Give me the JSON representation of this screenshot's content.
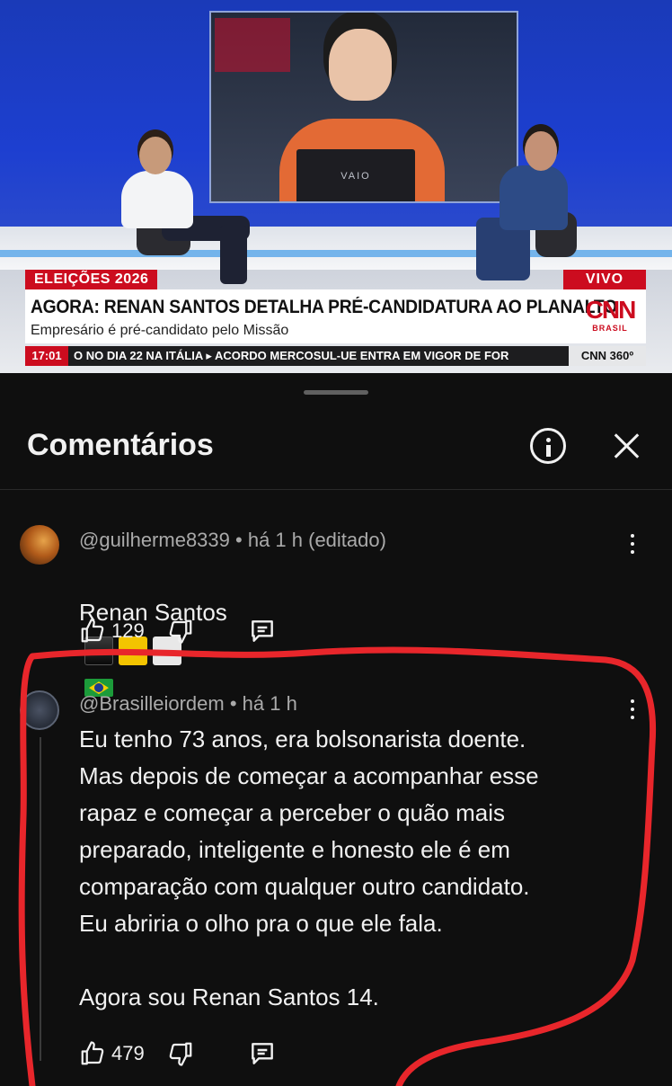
{
  "video": {
    "laptop_brand": "VAIO",
    "lower_third": {
      "tag": "ELEIÇÕES 2026",
      "live": "VIVO",
      "headline": "AGORA: RENAN SANTOS DETALHA PRÉ-CANDIDATURA AO PLANALTO",
      "subtitle": "Empresário é pré-candidato pelo Missão",
      "network_logo": "CNN",
      "network_sub": "BRASIL"
    },
    "ticker": {
      "time": "17:01",
      "text": "O NO DIA 22 NA ITÁLIA   ▸  ACORDO MERCOSUL-UE ENTRA EM VIGOR DE FOR",
      "badge": "CNN 360º"
    }
  },
  "sheet": {
    "title": "Comentários"
  },
  "comments": [
    {
      "author": "@guilherme8339",
      "time": "há 1 h",
      "edited": "(editado)",
      "text": "Renan Santos",
      "likes": "129"
    },
    {
      "author": "@Brasilleiordem",
      "time": "há 1 h",
      "text": "Eu tenho 73 anos, era bolsonarista doente.\nMas depois de começar a acompanhar esse\nrapaz e começar a perceber o quão mais\npreparado, inteligente e honesto ele é em\ncomparação com qualquer outro candidato.\nEu abriria o olho pra o que ele fala.\n\nAgora sou Renan Santos 14.",
      "likes": "479"
    }
  ],
  "colors": {
    "background": "#0f0f0f",
    "text_primary": "#f1f1f1",
    "text_secondary": "#aaaaaa",
    "cnn_red": "#cc0c1f",
    "highlight_marker": "#e8262b"
  }
}
